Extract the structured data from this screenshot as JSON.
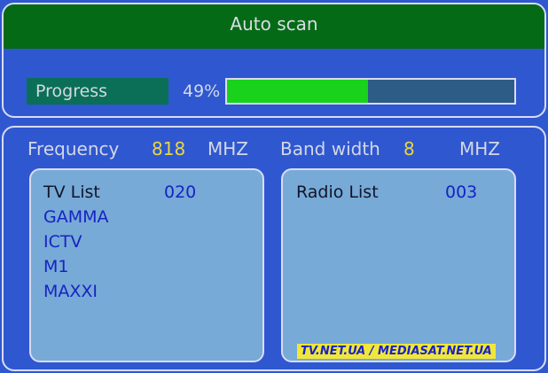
{
  "header": {
    "title": "Auto scan"
  },
  "progress": {
    "label": "Progress",
    "percent_text": "49%",
    "value": 0.49
  },
  "info": {
    "frequency_label": "Frequency",
    "frequency_value": "818",
    "frequency_unit": "MHZ",
    "bandwidth_label": "Band width",
    "bandwidth_value": "8",
    "bandwidth_unit": "MHZ"
  },
  "tv_list": {
    "title": "TV List",
    "count": "020",
    "channels": [
      "GAMMA",
      "ICTV",
      "M1",
      "MAXXI"
    ]
  },
  "radio_list": {
    "title": "Radio List",
    "count": "003"
  },
  "watermark": "TV.NET.UA / MEDIASAT.NET.UA",
  "colors": {
    "background": "#2f57d0",
    "title_bar": "#056a16",
    "progress_fill": "#18d21b",
    "progress_track": "#2d5c87",
    "list_box": "#77aad7",
    "highlight_value": "#e8d642",
    "channel_text": "#1723c2"
  }
}
